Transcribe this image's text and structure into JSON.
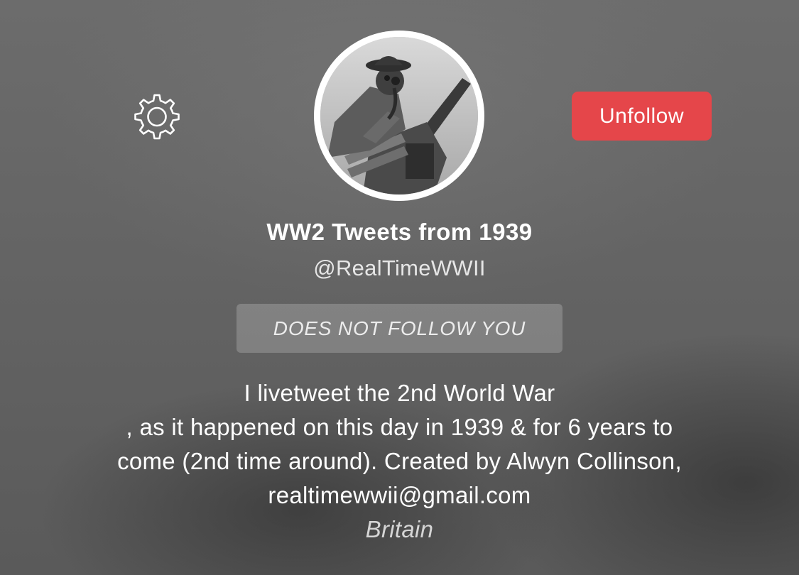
{
  "profile": {
    "display_name": "WW2 Tweets from 1939",
    "handle": "@RealTimeWWII",
    "follow_status": "DOES NOT FOLLOW YOU",
    "bio_lines": [
      "I livetweet the 2nd World War",
      ", as it happened on this day in 1939 & for 6 years to",
      "come (2nd time around). Created by Alwyn Collinson,",
      "realtimewwii@gmail.com"
    ],
    "location": "Britain"
  },
  "actions": {
    "unfollow_label": "Unfollow",
    "settings_icon": "gear-icon"
  },
  "colors": {
    "unfollow_button": "#e5464a",
    "background": "#646464"
  }
}
